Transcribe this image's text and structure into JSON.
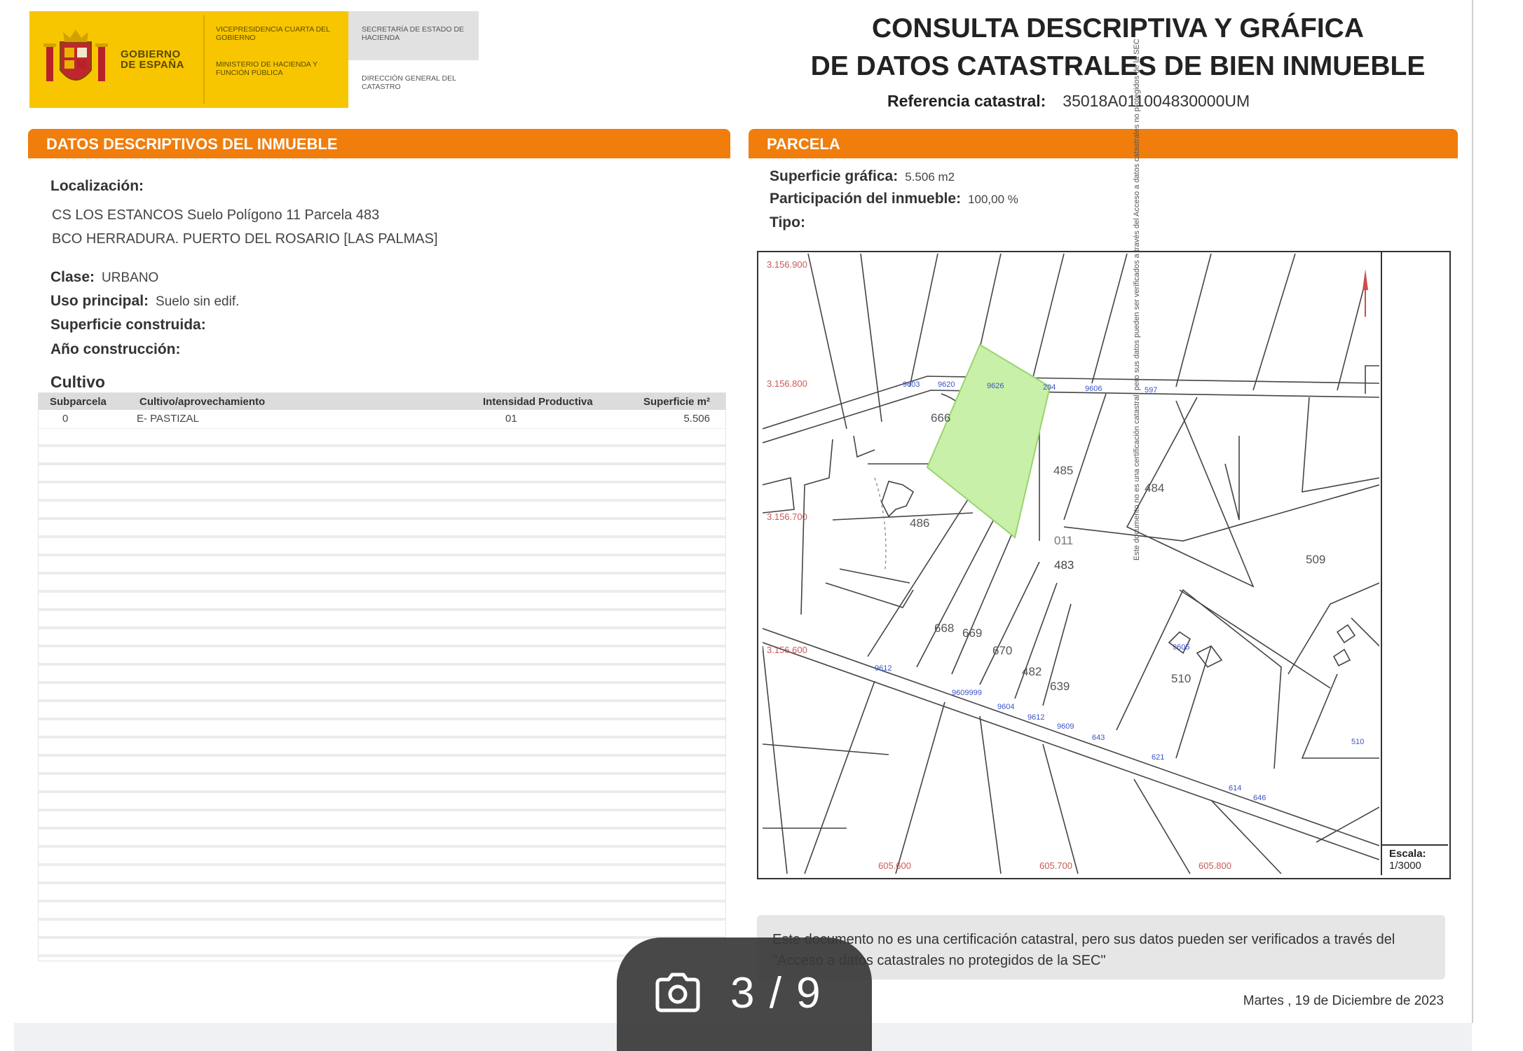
{
  "header": {
    "logo_gobierno": "GOBIERNO DE ESPAÑA",
    "logo_vicepresidencia": "VICEPRESIDENCIA CUARTA DEL GOBIERNO",
    "logo_ministerio": "MINISTERIO DE HACIENDA Y FUNCIÓN PÚBLICA",
    "logo_secretaria": "SECRETARÍA DE ESTADO DE HACIENDA",
    "logo_direccion": "DIRECCIÓN GENERAL DEL CATASTRO",
    "title_line1": "CONSULTA DESCRIPTIVA Y GRÁFICA",
    "title_line2": "DE DATOS CATASTRALES DE BIEN INMUEBLE",
    "ref_label": "Referencia catastral:",
    "ref_value": "35018A011004830000UM"
  },
  "left": {
    "section_title": "DATOS DESCRIPTIVOS DEL INMUEBLE",
    "localizacion_label": "Localización:",
    "address_line1": "CS LOS ESTANCOS  Suelo Polígono 11 Parcela 483",
    "address_line2": "BCO HERRADURA. PUERTO DEL ROSARIO [LAS PALMAS]",
    "clase_label": "Clase:",
    "clase_value": "URBANO",
    "uso_label": "Uso principal:",
    "uso_value": "Suelo sin edif.",
    "sup_label": "Superficie construida:",
    "ano_label": "Año construcción:",
    "cultivo_title": "Cultivo",
    "table": {
      "headers": [
        "Subparcela",
        "Cultivo/aprovechamiento",
        "Intensidad Productiva",
        "Superficie m²"
      ],
      "rows": [
        [
          "0",
          "E- PASTIZAL",
          "01",
          "5.506"
        ]
      ]
    }
  },
  "right": {
    "section_title": "PARCELA",
    "sup_grafica_label": "Superficie gráfica:",
    "sup_grafica_value": "5.506 m2",
    "participacion_label": "Participación del inmueble:",
    "participacion_value": "100,00 %",
    "tipo_label": "Tipo:",
    "map": {
      "y_coords": [
        "3.156.900",
        "3.156.800",
        "3.156.700",
        "3.156.600"
      ],
      "x_coords": [
        "605.600",
        "605.700",
        "605.800"
      ],
      "parcel_code": "011",
      "parcel_number": "483",
      "parcel_labels": [
        "486",
        "485",
        "484",
        "509",
        "666",
        "668",
        "669",
        "670",
        "482",
        "639",
        "510"
      ],
      "highlight_color": "#c8f0a8"
    },
    "escala_label": "Escala:",
    "escala_value": "1/3000",
    "legend_text": "Este documento no es una certificación catastral, pero sus datos pueden ser verificados a través del Acceso a datos catastrales no protegidos de la SEC",
    "note": "Este documento no es una certificación catastral, pero sus datos pueden ser verificados a través del \"Acceso a datos catastrales no protegidos de la SEC\"",
    "date": "Martes , 19 de Diciembre de 2023"
  },
  "viewer": {
    "counter": "3 / 9",
    "camera_icon": "camera-icon"
  },
  "colors": {
    "accent_orange": "#f07d0c",
    "logo_yellow": "#f7c600",
    "parcel_green": "#c8f0a8"
  }
}
